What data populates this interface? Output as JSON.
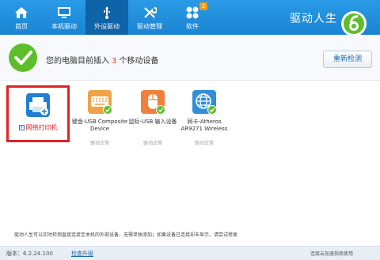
{
  "app_title": "驱动人生",
  "nav": [
    {
      "label": "首页",
      "icon": "home-icon"
    },
    {
      "label": "本机驱动",
      "icon": "monitor-icon"
    },
    {
      "label": "外设驱动",
      "icon": "usb-icon",
      "active": true
    },
    {
      "label": "驱动管理",
      "icon": "tools-icon"
    },
    {
      "label": "软件",
      "icon": "apps-icon",
      "badge": "2"
    }
  ],
  "status": {
    "prefix": "您的电脑目前插入",
    "count": "3",
    "suffix": "个移动设备",
    "redetect_button": "重新检测"
  },
  "devices": [
    {
      "name": "网络打印机",
      "status": "",
      "icon": "printer-icon",
      "add_action": true
    },
    {
      "name": "键盘-USB Composite Device",
      "status": "驱动正常",
      "icon": "keyboard-icon"
    },
    {
      "name": "鼠标-USB 输入设备",
      "status": "驱动正常",
      "icon": "mouse-icon"
    },
    {
      "name": "网卡-Atheros AR9271 Wireless",
      "status": "驱动正常",
      "icon": "network-icon"
    }
  ],
  "info_line": "驱动人生可以实时检测直接连接至本机的外部设备，无需单独添加；如果设备已连接却未显示，请尝试修复",
  "footer": {
    "version": "版本：6.2.24.100",
    "check_update": "检查升级",
    "right_note": "连接云加速指南使用"
  },
  "colors": {
    "topbar": "#1a84d2",
    "active_tab": "#0f63a8",
    "check_green": "#5cbf2a",
    "highlight_red": "#e02222"
  }
}
